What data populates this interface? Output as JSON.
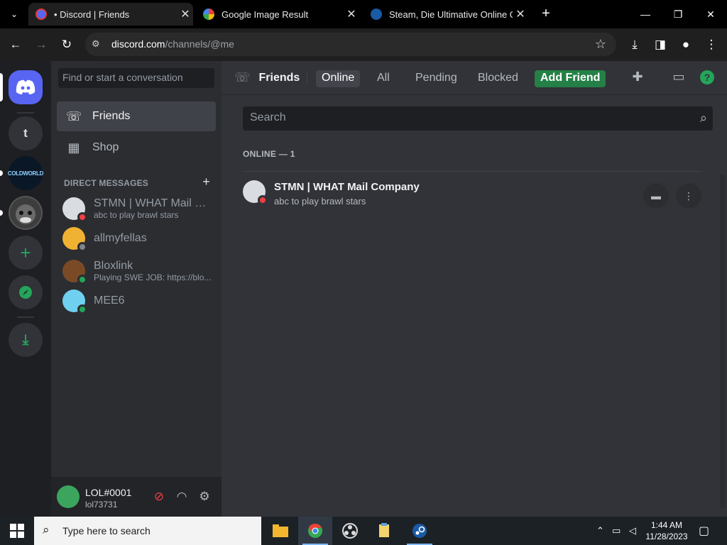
{
  "browser": {
    "tabs": [
      {
        "title": "• Discord | Friends",
        "active": true
      },
      {
        "title": "Google Image Result",
        "active": false
      },
      {
        "title": "Steam, Die Ultimative Online Ga",
        "active": false
      }
    ],
    "url_domain": "discord.com",
    "url_path": "/channels/@me"
  },
  "guilds": [
    {
      "label": "t"
    },
    {
      "label": "COLDWORLD"
    }
  ],
  "channels": {
    "find_placeholder": "Find or start a conversation",
    "nav": [
      {
        "label": "Friends"
      },
      {
        "label": "Shop"
      }
    ],
    "dm_header": "DIRECT MESSAGES",
    "dms": [
      {
        "name": "STMN | WHAT Mail Co...",
        "sub": "abc to play brawl stars",
        "status": "dnd",
        "color": "#d9dde2"
      },
      {
        "name": "allmyfellas",
        "sub": "",
        "status": "offline",
        "color": "#f0b232"
      },
      {
        "name": "Bloxlink",
        "sub": "Playing SWE JOB: https://blo...",
        "status": "online",
        "color": "#7a4a26"
      },
      {
        "name": "MEE6",
        "sub": "",
        "status": "online",
        "color": "#6fd0f0"
      }
    ]
  },
  "user": {
    "name": "LOL#0001",
    "tag": "lol73731"
  },
  "topbar": {
    "title": "Friends",
    "tabs": [
      "Online",
      "All",
      "Pending",
      "Blocked"
    ],
    "add_friend": "Add Friend"
  },
  "main": {
    "search_placeholder": "Search",
    "section": "ONLINE — 1",
    "friend": {
      "name": "STMN | WHAT Mail Company",
      "activity": "abc to play brawl stars"
    }
  },
  "taskbar": {
    "search_placeholder": "Type here to search",
    "time": "1:44 AM",
    "date": "11/28/2023"
  },
  "colors": {
    "blurple": "#5865f2",
    "green": "#248046",
    "online": "#23a55a",
    "dnd": "#f23f43"
  }
}
